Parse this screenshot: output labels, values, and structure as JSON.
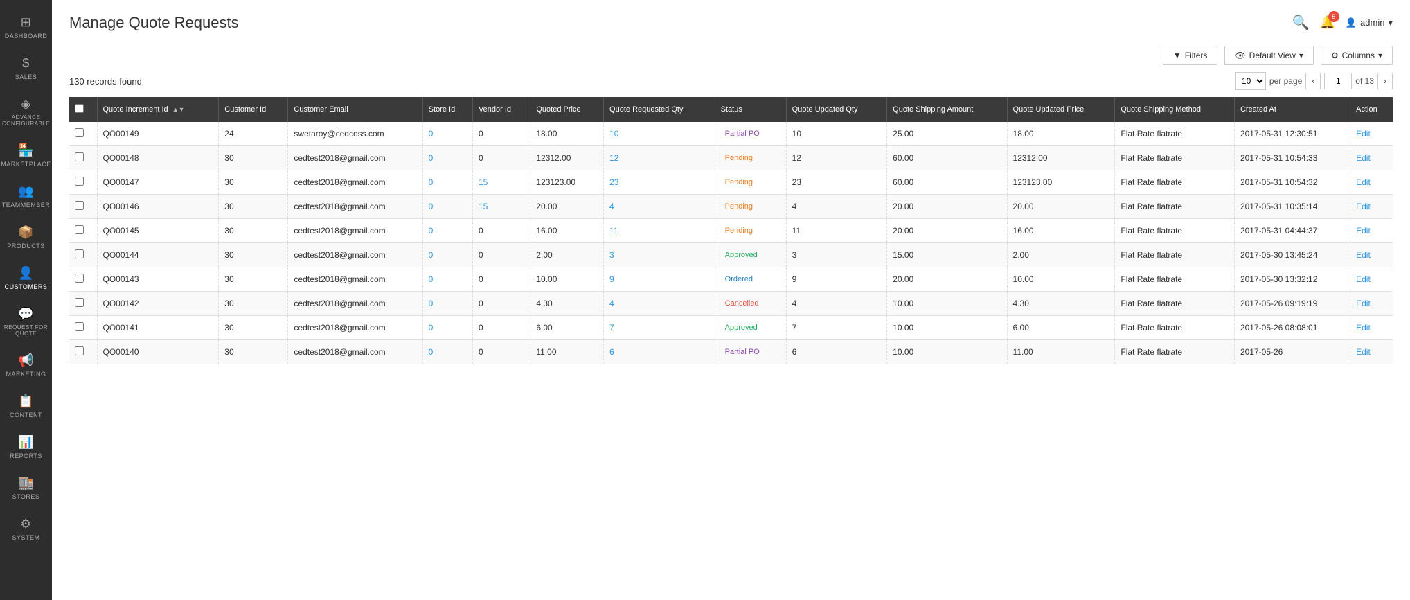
{
  "page": {
    "title": "Manage Quote Requests",
    "records_count": "130 records found"
  },
  "header": {
    "notifications_count": "5",
    "admin_label": "admin",
    "search_icon": "🔍",
    "bell_icon": "🔔",
    "user_icon": "👤"
  },
  "toolbar": {
    "filters_label": "Filters",
    "view_label": "Default View",
    "columns_label": "Columns"
  },
  "pagination": {
    "per_page": "10",
    "per_page_label": "per page",
    "current_page": "1",
    "total_pages": "of 13"
  },
  "table": {
    "columns": [
      "Quote Increment Id",
      "Customer Id",
      "Customer Email",
      "Store Id",
      "Vendor Id",
      "Quoted Price",
      "Quote Requested Qty",
      "Status",
      "Quote Updated Qty",
      "Quote Shipping Amount",
      "Quote Updated Price",
      "Quote Shipping Method",
      "Created At",
      "Action"
    ],
    "rows": [
      {
        "quote_increment_id": "QO00149",
        "customer_id": "24",
        "customer_email": "swetaroy@cedcoss.com",
        "store_id": "0",
        "vendor_id": "0",
        "quoted_price": "18.00",
        "quote_requested_qty": "10",
        "status": "Partial PO",
        "quote_updated_qty": "10",
        "quote_shipping_amount": "25.00",
        "quote_updated_price": "18.00",
        "quote_shipping_method": "Flat Rate flatrate",
        "created_at": "2017-05-31 12:30:51",
        "action": "Edit"
      },
      {
        "quote_increment_id": "QO00148",
        "customer_id": "30",
        "customer_email": "cedtest2018@gmail.com",
        "store_id": "0",
        "vendor_id": "0",
        "quoted_price": "12312.00",
        "quote_requested_qty": "12",
        "status": "Pending",
        "quote_updated_qty": "12",
        "quote_shipping_amount": "60.00",
        "quote_updated_price": "12312.00",
        "quote_shipping_method": "Flat Rate flatrate",
        "created_at": "2017-05-31 10:54:33",
        "action": "Edit"
      },
      {
        "quote_increment_id": "QO00147",
        "customer_id": "30",
        "customer_email": "cedtest2018@gmail.com",
        "store_id": "0",
        "vendor_id": "15",
        "quoted_price": "123123.00",
        "quote_requested_qty": "23",
        "status": "Pending",
        "quote_updated_qty": "23",
        "quote_shipping_amount": "60.00",
        "quote_updated_price": "123123.00",
        "quote_shipping_method": "Flat Rate flatrate",
        "created_at": "2017-05-31 10:54:32",
        "action": "Edit"
      },
      {
        "quote_increment_id": "QO00146",
        "customer_id": "30",
        "customer_email": "cedtest2018@gmail.com",
        "store_id": "0",
        "vendor_id": "15",
        "quoted_price": "20.00",
        "quote_requested_qty": "4",
        "status": "Pending",
        "quote_updated_qty": "4",
        "quote_shipping_amount": "20.00",
        "quote_updated_price": "20.00",
        "quote_shipping_method": "Flat Rate flatrate",
        "created_at": "2017-05-31 10:35:14",
        "action": "Edit"
      },
      {
        "quote_increment_id": "QO00145",
        "customer_id": "30",
        "customer_email": "cedtest2018@gmail.com",
        "store_id": "0",
        "vendor_id": "0",
        "quoted_price": "16.00",
        "quote_requested_qty": "11",
        "status": "Pending",
        "quote_updated_qty": "11",
        "quote_shipping_amount": "20.00",
        "quote_updated_price": "16.00",
        "quote_shipping_method": "Flat Rate flatrate",
        "created_at": "2017-05-31 04:44:37",
        "action": "Edit"
      },
      {
        "quote_increment_id": "QO00144",
        "customer_id": "30",
        "customer_email": "cedtest2018@gmail.com",
        "store_id": "0",
        "vendor_id": "0",
        "quoted_price": "2.00",
        "quote_requested_qty": "3",
        "status": "Approved",
        "quote_updated_qty": "3",
        "quote_shipping_amount": "15.00",
        "quote_updated_price": "2.00",
        "quote_shipping_method": "Flat Rate flatrate",
        "created_at": "2017-05-30 13:45:24",
        "action": "Edit"
      },
      {
        "quote_increment_id": "QO00143",
        "customer_id": "30",
        "customer_email": "cedtest2018@gmail.com",
        "store_id": "0",
        "vendor_id": "0",
        "quoted_price": "10.00",
        "quote_requested_qty": "9",
        "status": "Ordered",
        "quote_updated_qty": "9",
        "quote_shipping_amount": "20.00",
        "quote_updated_price": "10.00",
        "quote_shipping_method": "Flat Rate flatrate",
        "created_at": "2017-05-30 13:32:12",
        "action": "Edit"
      },
      {
        "quote_increment_id": "QO00142",
        "customer_id": "30",
        "customer_email": "cedtest2018@gmail.com",
        "store_id": "0",
        "vendor_id": "0",
        "quoted_price": "4.30",
        "quote_requested_qty": "4",
        "status": "Cancelled",
        "quote_updated_qty": "4",
        "quote_shipping_amount": "10.00",
        "quote_updated_price": "4.30",
        "quote_shipping_method": "Flat Rate flatrate",
        "created_at": "2017-05-26 09:19:19",
        "action": "Edit"
      },
      {
        "quote_increment_id": "QO00141",
        "customer_id": "30",
        "customer_email": "cedtest2018@gmail.com",
        "store_id": "0",
        "vendor_id": "0",
        "quoted_price": "6.00",
        "quote_requested_qty": "7",
        "status": "Approved",
        "quote_updated_qty": "7",
        "quote_shipping_amount": "10.00",
        "quote_updated_price": "6.00",
        "quote_shipping_method": "Flat Rate flatrate",
        "created_at": "2017-05-26 08:08:01",
        "action": "Edit"
      },
      {
        "quote_increment_id": "QO00140",
        "customer_id": "30",
        "customer_email": "cedtest2018@gmail.com",
        "store_id": "0",
        "vendor_id": "0",
        "quoted_price": "11.00",
        "quote_requested_qty": "6",
        "status": "Partial PO",
        "quote_updated_qty": "6",
        "quote_shipping_amount": "10.00",
        "quote_updated_price": "11.00",
        "quote_shipping_method": "Flat Rate flatrate",
        "created_at": "2017-05-26",
        "action": "Edit"
      }
    ]
  },
  "sidebar": {
    "items": [
      {
        "id": "dashboard",
        "label": "Dashboard",
        "icon": "⊞"
      },
      {
        "id": "sales",
        "label": "Sales",
        "icon": "$"
      },
      {
        "id": "advance-configurable",
        "label": "Advance Configurable",
        "icon": "◈"
      },
      {
        "id": "marketplace",
        "label": "Marketplace",
        "icon": "🏪"
      },
      {
        "id": "teammember",
        "label": "Teammember",
        "icon": "👥"
      },
      {
        "id": "products",
        "label": "Products",
        "icon": "📦"
      },
      {
        "id": "customers",
        "label": "Customers",
        "icon": "👤"
      },
      {
        "id": "request-for-quote",
        "label": "Request For Quote",
        "icon": "💬"
      },
      {
        "id": "marketing",
        "label": "Marketing",
        "icon": "📢"
      },
      {
        "id": "content",
        "label": "Content",
        "icon": "📋"
      },
      {
        "id": "reports",
        "label": "Reports",
        "icon": "📊"
      },
      {
        "id": "stores",
        "label": "Stores",
        "icon": "🏬"
      },
      {
        "id": "system",
        "label": "System",
        "icon": "⚙"
      }
    ]
  }
}
